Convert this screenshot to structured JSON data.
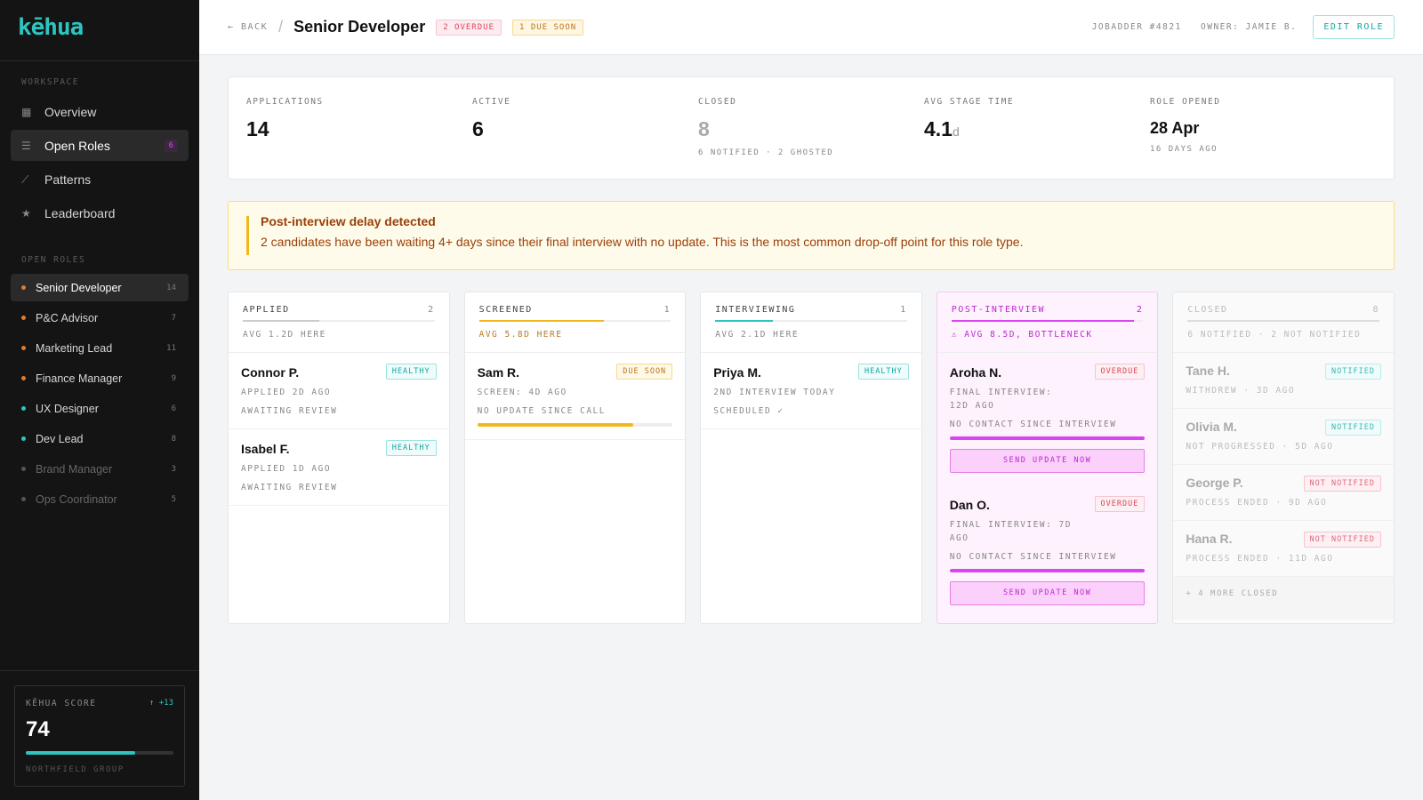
{
  "app": {
    "logo": "kēhua"
  },
  "sidebar": {
    "workspace_label": "WORKSPACE",
    "nav": [
      {
        "label": "Overview",
        "icon": "grid-icon"
      },
      {
        "label": "Open Roles",
        "icon": "list-icon",
        "badge": "6",
        "active": true
      },
      {
        "label": "Patterns",
        "icon": "trend-icon"
      },
      {
        "label": "Leaderboard",
        "icon": "star-icon"
      }
    ],
    "roles_label": "OPEN ROLES",
    "roles": [
      {
        "label": "Senior Developer",
        "count": "14",
        "color": "#e07b2e",
        "active": true
      },
      {
        "label": "P&C Advisor",
        "count": "7",
        "color": "#e07b2e"
      },
      {
        "label": "Marketing Lead",
        "count": "11",
        "color": "#e07b2e"
      },
      {
        "label": "Finance Manager",
        "count": "9",
        "color": "#e07b2e"
      },
      {
        "label": "UX Designer",
        "count": "6",
        "color": "#2ec4c0"
      },
      {
        "label": "Dev Lead",
        "count": "8",
        "color": "#2ec4c0"
      },
      {
        "label": "Brand Manager",
        "count": "3",
        "color": "#555555",
        "dim": true
      },
      {
        "label": "Ops Coordinator",
        "count": "5",
        "color": "#555555",
        "dim": true
      }
    ],
    "score": {
      "label": "KĒHUA SCORE",
      "delta": "↑ +13",
      "value": "74",
      "progress": 0.74,
      "org": "NORTHFIELD GROUP"
    }
  },
  "header": {
    "back": "← BACK",
    "title": "Senior Developer",
    "tag_overdue": "2 OVERDUE",
    "tag_due": "1 DUE SOON",
    "jobadder": "JOBADDER #4821",
    "owner": "OWNER: JAMIE B.",
    "edit": "EDIT ROLE"
  },
  "stats": [
    {
      "label": "APPLICATIONS",
      "value": "14"
    },
    {
      "label": "ACTIVE",
      "value": "6"
    },
    {
      "label": "CLOSED",
      "value": "8",
      "sub": "6 NOTIFIED · 2 GHOSTED"
    },
    {
      "label": "AVG STAGE TIME",
      "value": "4.1",
      "unit": "d"
    },
    {
      "label": "ROLE OPENED",
      "value": "28 Apr",
      "sub": "16 DAYS AGO"
    }
  ],
  "alert": {
    "title": "Post-interview delay detected",
    "body": "2 candidates have been waiting 4+ days since their final interview with no update. This is the most common drop-off point for this role type."
  },
  "columns": [
    {
      "name": "APPLIED",
      "count": "2",
      "avg": "AVG 1.2D HERE",
      "line_color": "#cccccc",
      "line_pct": 0.4,
      "cards": [
        {
          "name": "Connor P.",
          "status": "HEALTHY",
          "d1": "APPLIED 2D AGO",
          "d2": "AWAITING REVIEW"
        },
        {
          "name": "Isabel F.",
          "status": "HEALTHY",
          "d1": "APPLIED 1D AGO",
          "d2": "AWAITING REVIEW"
        }
      ]
    },
    {
      "name": "SCREENED",
      "count": "1",
      "avg": "AVG 5.8D HERE",
      "line_color": "#f2b81b",
      "line_pct": 0.65,
      "cards": [
        {
          "name": "Sam R.",
          "status": "DUE SOON",
          "d1": "SCREEN: 4D AGO",
          "d2": "NO UPDATE SINCE CALL",
          "progress": 0.8
        }
      ]
    },
    {
      "name": "INTERVIEWING",
      "count": "1",
      "avg": "AVG 2.1D HERE",
      "line_color": "#2ec4c0",
      "line_pct": 0.3,
      "cards": [
        {
          "name": "Priya M.",
          "status": "HEALTHY",
          "d1": "2ND INTERVIEW TODAY",
          "d2": "SCHEDULED ✓"
        }
      ]
    },
    {
      "name": "POST-INTERVIEW",
      "count": "2",
      "avg": "⚠ AVG 8.5D, BOTTLENECK",
      "line_color": "#d946ef",
      "line_pct": 0.95,
      "cards": [
        {
          "name": "Aroha N.",
          "status": "OVERDUE",
          "d1": "FINAL INTERVIEW: 12D AGO",
          "d2": "NO CONTACT SINCE INTERVIEW",
          "progress": 1,
          "action": "SEND UPDATE NOW"
        },
        {
          "name": "Dan O.",
          "status": "OVERDUE",
          "d1": "FINAL INTERVIEW: 7D AGO",
          "d2": "NO CONTACT SINCE INTERVIEW",
          "progress": 1,
          "action": "SEND UPDATE NOW"
        }
      ]
    },
    {
      "name": "CLOSED",
      "count": "8",
      "avg": "6 NOTIFIED · 2 NOT NOTIFIED",
      "line_color": "#dddddd",
      "line_pct": 1,
      "cards": [
        {
          "name": "Tane H.",
          "status": "NOTIFIED",
          "d1": "WITHDREW · 3D AGO"
        },
        {
          "name": "Olivia M.",
          "status": "NOTIFIED",
          "d1": "NOT PROGRESSED · 5D AGO"
        },
        {
          "name": "George P.",
          "status": "NOT NOTIFIED",
          "d1": "PROCESS ENDED · 9D AGO"
        },
        {
          "name": "Hana R.",
          "status": "NOT NOTIFIED",
          "d1": "PROCESS ENDED · 11D AGO"
        }
      ],
      "more": "+ 4 MORE CLOSED"
    }
  ]
}
